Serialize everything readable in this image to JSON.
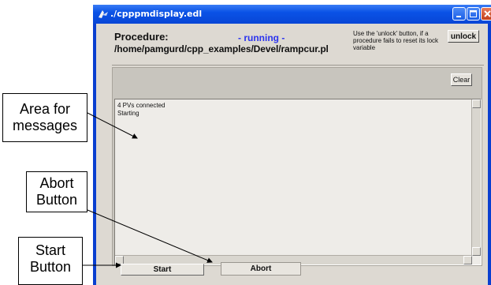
{
  "window": {
    "title": "./cpppmdisplay.edl"
  },
  "procedure": {
    "label": "Procedure:",
    "path": "/home/pamgurd/cpp_examples/Devel/rampcur.pl",
    "status": "- running -"
  },
  "hint": {
    "text": "Use the 'unlock' button, if a procedure fails to reset its lock variable"
  },
  "buttons": {
    "unlock": "unlock",
    "clear": "Clear",
    "start": "Start",
    "abort": "Abort"
  },
  "messages": {
    "lines": "4 PVs connected\nStarting"
  },
  "annotations": {
    "area_line1": "Area for",
    "area_line2": "messages",
    "abort_line1": "Abort",
    "abort_line2": "Button",
    "start_line1": "Start",
    "start_line2": "Button"
  },
  "colors": {
    "titlebar": "#0a52e6",
    "status_text": "#2a33ee",
    "client_bg": "#ddd9d2"
  }
}
